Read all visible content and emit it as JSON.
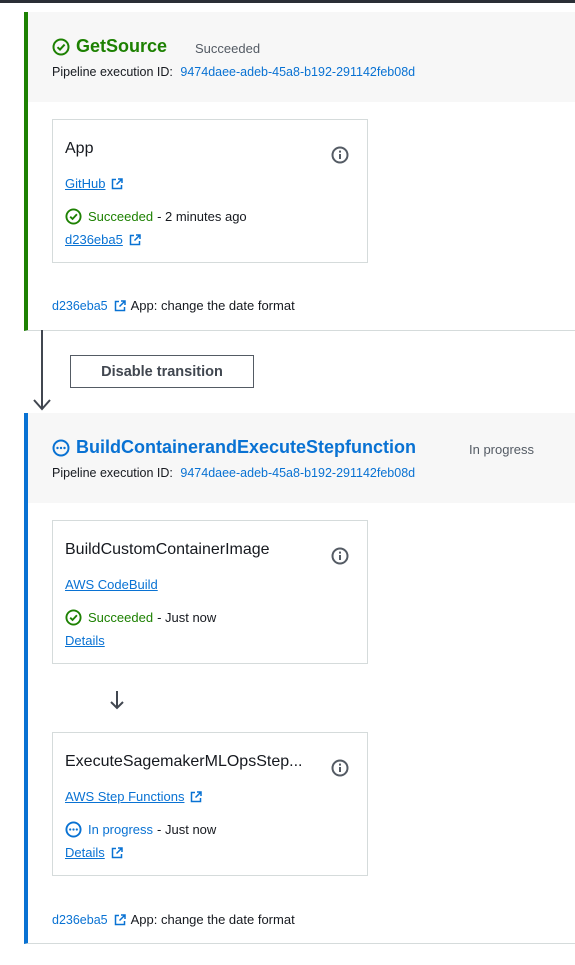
{
  "stages": [
    {
      "title": "GetSource",
      "status": "Succeeded",
      "exec_label": "Pipeline execution ID:",
      "exec_id": "9474daee-adeb-45a8-b192-291142feb08d",
      "actions": [
        {
          "title": "App",
          "provider": "GitHub",
          "status": "Succeeded",
          "time": "- 2 minutes ago",
          "link": "d236eba5"
        }
      ],
      "commit": {
        "id": "d236eba5",
        "message": "App: change the date format"
      }
    },
    {
      "title": "BuildContainerandExecuteStepfunction",
      "status": "In progress",
      "exec_label": "Pipeline execution ID:",
      "exec_id": "9474daee-adeb-45a8-b192-291142feb08d",
      "actions": [
        {
          "title": "BuildCustomContainerImage",
          "provider": "AWS CodeBuild",
          "status": "Succeeded",
          "time": "- Just now",
          "link": "Details"
        },
        {
          "title": "ExecuteSagemakerMLOpsStep...",
          "provider": "AWS Step Functions",
          "status": "In progress",
          "time": "- Just now",
          "link": "Details"
        }
      ],
      "commit": {
        "id": "d236eba5",
        "message": "App: change the date format"
      }
    }
  ],
  "transition": {
    "button_label": "Disable transition"
  },
  "icons": {
    "success": "check-circle-icon",
    "in_progress": "ellipsis-circle-icon",
    "info": "info-circle-icon",
    "external": "external-link-icon",
    "transition_arrow": "arrow-down-icon"
  },
  "colors": {
    "success": "#1d8102",
    "link": "#0972d3",
    "text": "#16191f",
    "muted": "#545b64"
  }
}
